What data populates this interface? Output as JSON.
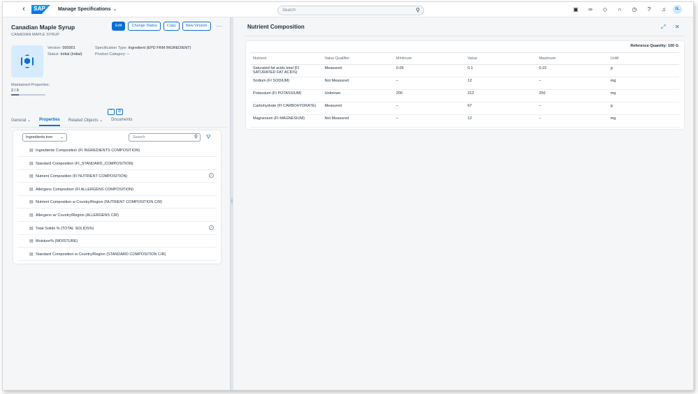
{
  "shell": {
    "app_title": "Manage Specifications",
    "logo_text": "SAP",
    "search_placeholder": "Search",
    "avatar_initials": "IL",
    "icons": [
      "feedback-icon",
      "binoculars-icon",
      "diamond-icon",
      "headset-icon",
      "history-icon",
      "help-icon",
      "notification-bell-icon"
    ]
  },
  "object": {
    "title": "Canadian Maple Syrup",
    "subtitle": "CANADIAN MAPLE SYRUP",
    "buttons": {
      "edit": "Edit",
      "change_status": "Change Status",
      "copy": "Copy",
      "new_version": "New Version",
      "more": "···"
    },
    "version_label": "Version:",
    "version_value": "000001",
    "status_label": "Status:",
    "status_value": "Initial (Initial)",
    "spec_type_label": "Specification Type:",
    "spec_type_value": "Ingredient (EPD FRM INGREDIENT)",
    "product_category_label": "Product Category:",
    "product_category_value": "–",
    "maintained_label": "Maintained Properties:",
    "maintained_value": "2 / 9",
    "maintained_fraction": 0.22
  },
  "tabs": [
    {
      "label": "General",
      "has_dropdown": true
    },
    {
      "label": "Properties",
      "active": true
    },
    {
      "label": "Related Objects",
      "has_dropdown": true
    },
    {
      "label": "Documents"
    }
  ],
  "tree": {
    "select_value": "Ingredients tree",
    "search_placeholder": "Search",
    "rows": [
      {
        "label": "Ingredients Composition (FI INGREDIENTS COMPOSITION)",
        "checked": false
      },
      {
        "label": "Standard Composition (FI_STANDARD_COMPOSITION)",
        "checked": false
      },
      {
        "label": "Nutrient Composition (FI NUTRIENT COMPOSITION)",
        "checked": true
      },
      {
        "label": "Allergens Composition (FI ALLERGENS COMPOSITION)",
        "checked": false
      },
      {
        "label": "Nutrient Composition w Country/Region (NUTRIENT COMPOSITION C/R)",
        "checked": false
      },
      {
        "label": "Allergens w/ Country/Region (ALLERGENS C/R)",
        "checked": false
      },
      {
        "label": "Total Solids % (TOTAL SOLIDS%)",
        "checked": true
      },
      {
        "label": "Moisture% (MOISTURE)",
        "checked": false
      },
      {
        "label": "Standard Composition w Country/Region (STANDARD COMPOSITION C/R)",
        "checked": false
      }
    ]
  },
  "detail": {
    "title": "Nutrient Composition",
    "reference_quantity": "Reference Quantity: 100 G",
    "columns": [
      "Nutrient",
      "Value Qualifier",
      "Minimum",
      "Value",
      "Maximum",
      "UoM"
    ],
    "rows": [
      [
        "Saturated fat acids total (FI SATURATED FAT ACIDS)",
        "Measured",
        "0.05",
        "0.1",
        "0.15",
        "g"
      ],
      [
        "Sodium (FI SODIUM)",
        "Not Measured",
        "–",
        "12",
        "–",
        "mg"
      ],
      [
        "Potassium (FI POTASSIUM)",
        "Unknown",
        "200",
        "212",
        "250",
        "mg"
      ],
      [
        "Carbohydrate (FI CARBOHYDRATE)",
        "Measured",
        "–",
        "67",
        "–",
        "g"
      ],
      [
        "Magnesium (FI MAGNESIUM)",
        "Not Measured",
        "–",
        "12",
        "–",
        "mg"
      ]
    ]
  }
}
